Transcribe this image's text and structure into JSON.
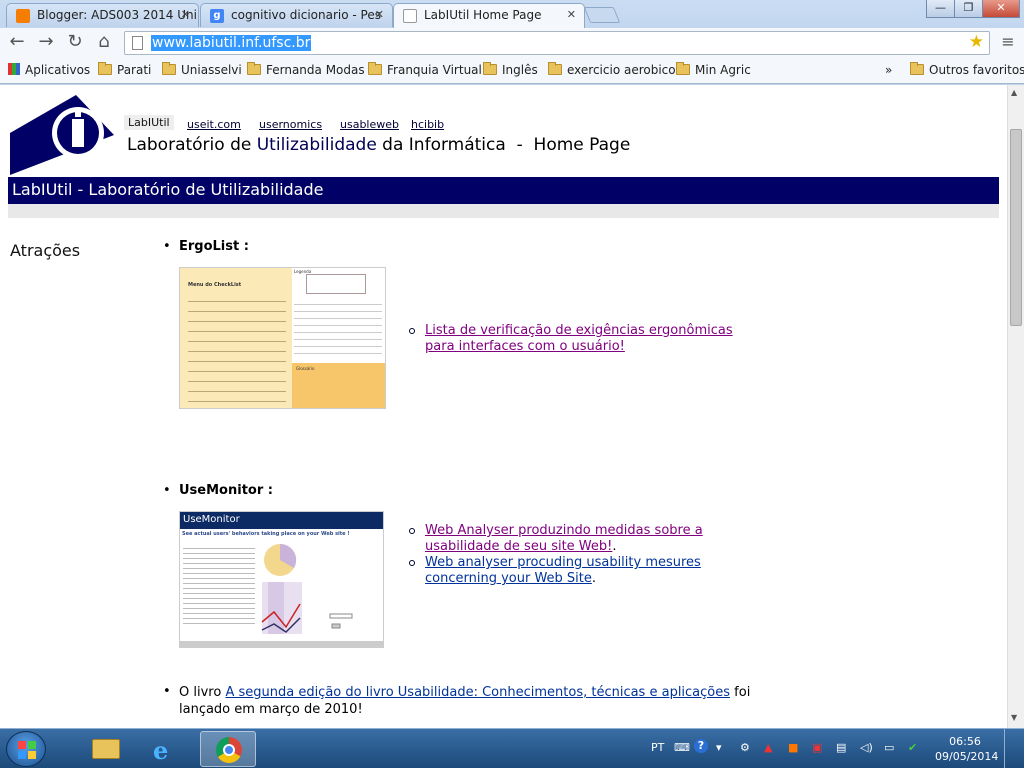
{
  "browser": {
    "tabs": [
      {
        "title": "Blogger: ADS003 2014 Uni",
        "icon": "blogger-icon",
        "color": "#f57d00"
      },
      {
        "title": "cognitivo dicionario - Pes",
        "icon": "google-icon",
        "color": "#4285f4"
      },
      {
        "title": "LabIUtil Home Page",
        "icon": "page-icon",
        "color": "#ffffff"
      }
    ],
    "url": "www.labiutil.inf.ufsc.br",
    "bookmarks": [
      "Aplicativos",
      "Parati",
      "Uniasselvi",
      "Fernanda Modas",
      "Franquia Virtual",
      "Inglês",
      "exercicio aerobico",
      "Min Agric"
    ],
    "more_bookmarks": "»",
    "other_bookmarks": "Outros favoritos"
  },
  "page": {
    "tag": "LabIUtil",
    "nav_links": [
      "useit.com",
      "usernomics",
      "usableweb",
      "hcibib"
    ],
    "title_pre": "Laboratório de ",
    "title_hl": "Utilizabilidade",
    "title_post": " da Informática  -  Home Page",
    "banner": "LabIUtil - Laboratório de Utilizabilidade",
    "section": "Atrações",
    "ergolist": {
      "title": "ErgoList :",
      "link": "Lista de verificação de exigências ergonômicas para interfaces com o usuário!",
      "shot_heading": "Menu do CheckList",
      "shot_panel": "Legenda",
      "shot_panel2": "Glossário"
    },
    "usemonitor": {
      "title": "UseMonitor :",
      "shot_header": "UseMonitor",
      "shot_sub": "See actual users' behaviors taking place on your Web site !",
      "link1": "Web Analyser produzindo medidas sobre a usabilidade de seu site Web!",
      "link1_suffix": ".",
      "link2": "Web analyser procuding usability mesures concerning your Web Site",
      "link2_suffix": "."
    },
    "book": {
      "prefix": "O livro ",
      "link": "A segunda edição do livro Usabilidade: Conhecimentos, técnicas e aplicações",
      "suffix": " foi lançado em março de 2010!"
    }
  },
  "taskbar": {
    "language": "PT",
    "time": "06:56",
    "date": "09/05/2014"
  },
  "colors": {
    "banner": "#000066",
    "visited_link": "#800080",
    "link": "#003399"
  }
}
